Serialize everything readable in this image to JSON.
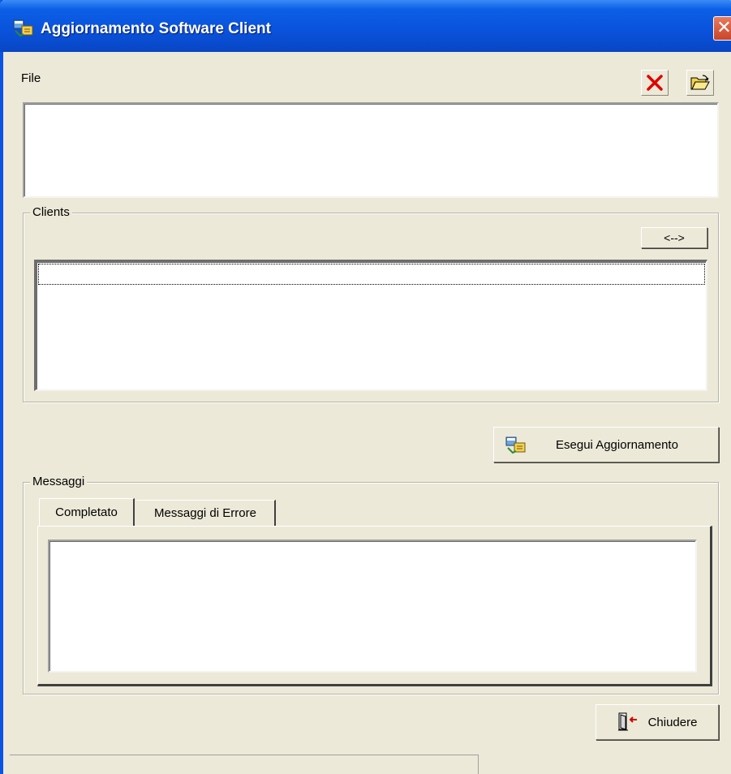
{
  "window": {
    "title": "Aggiornamento Software Client",
    "close_glyph": "✕",
    "title_icon": "update-app-icon"
  },
  "file_section": {
    "label": "File",
    "clear_icon": "delete-x-icon",
    "open_icon": "open-folder-icon",
    "value": ""
  },
  "clients": {
    "title": "Clients",
    "toggle_label": "<-->",
    "items": []
  },
  "actions": {
    "run_update_label": "Esegui Aggiornamento",
    "run_update_icon": "update-app-icon"
  },
  "messages": {
    "title": "Messaggi",
    "tabs": [
      {
        "label": "Completato",
        "active": true
      },
      {
        "label": "Messaggi di Errore",
        "active": false
      }
    ],
    "content": ""
  },
  "footer": {
    "close_label": "Chiudere",
    "close_icon": "exit-door-icon"
  },
  "colors": {
    "titlebar": "#0a52db",
    "window_bg": "#ece9d8",
    "close_button": "#c8452a",
    "delete_icon": "#e00000"
  }
}
